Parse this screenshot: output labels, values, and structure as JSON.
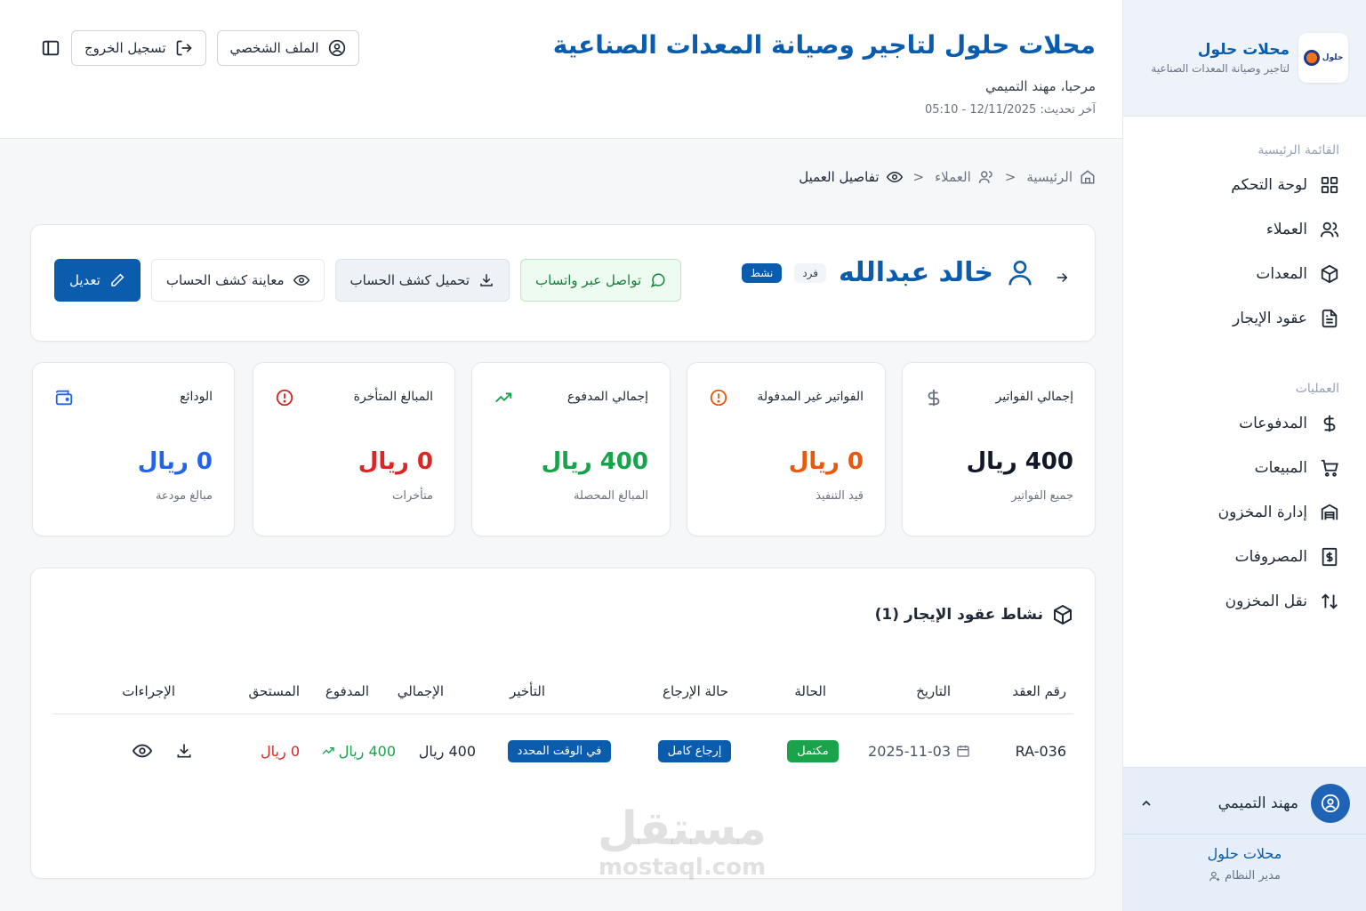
{
  "sidebar": {
    "brand_name": "محلات حلول",
    "brand_sub": "لتاجير وصيانة المعدات الصناعية",
    "logo_text": "حلول",
    "sections": [
      {
        "title": "القائمة الرئيسية",
        "items": [
          {
            "label": "لوحة التحكم",
            "icon": "dashboard-grid-icon"
          },
          {
            "label": "العملاء",
            "icon": "users-icon"
          },
          {
            "label": "المعدات",
            "icon": "box-icon"
          },
          {
            "label": "عقود الإيجار",
            "icon": "document-icon"
          }
        ]
      },
      {
        "title": "العمليات",
        "items": [
          {
            "label": "المدفوعات",
            "icon": "dollar-icon"
          },
          {
            "label": "المبيعات",
            "icon": "cart-icon"
          },
          {
            "label": "إدارة المخزون",
            "icon": "warehouse-icon"
          },
          {
            "label": "المصروفات",
            "icon": "receipt-dollar-icon"
          },
          {
            "label": "نقل المخزون",
            "icon": "transfer-arrows-icon"
          }
        ]
      }
    ],
    "user": {
      "name": "مهند التميمي",
      "org": "محلات حلول",
      "role": "مدير النظام"
    }
  },
  "header": {
    "title": "محلات حلول لتاجير وصيانة المعدات الصناعية",
    "welcome": "مرحبا، مهند التميمي",
    "last_updated": "آخر تحديث: 12/11/2025 - 05:10",
    "profile_label": "الملف الشخصي",
    "logout_label": "تسجيل الخروج"
  },
  "breadcrumb": {
    "home": "الرئيسية",
    "clients": "العملاء",
    "current": "تفاصيل العميل"
  },
  "client": {
    "name": "خالد عبدالله",
    "type_badge": "فرد",
    "status_badge": "نشط",
    "whatsapp_label": "تواصل عبر واتساب",
    "download_label": "تحميل كشف الحساب",
    "preview_label": "معاينة كشف الحساب",
    "edit_label": "تعديل"
  },
  "stats": [
    {
      "label": "إجمالي الفواتير",
      "value": "400 ريال",
      "sub": "جميع الفواتير",
      "color": "#111827",
      "icon": "dollar-icon"
    },
    {
      "label": "الفواتير غير المدفولة",
      "value": "0 ريال",
      "sub": "قيد التنفيذ",
      "color": "#ea580c",
      "icon": "alert-circle-icon"
    },
    {
      "label": "إجمالي المدفوع",
      "value": "400 ريال",
      "sub": "المبالغ المحصلة",
      "color": "#16a34a",
      "icon": "trending-up-icon"
    },
    {
      "label": "المبالغ المتأخرة",
      "value": "0 ريال",
      "sub": "متأخرات",
      "color": "#dc2626",
      "icon": "alert-circle-icon"
    },
    {
      "label": "الودائع",
      "value": "0 ريال",
      "sub": "مبالغ مودعة",
      "color": "#2563eb",
      "icon": "wallet-icon"
    }
  ],
  "contracts": {
    "title": "نشاط عقود الإيجار (1)",
    "columns": [
      "رقم العقد",
      "التاريخ",
      "الحالة",
      "حالة الإرجاع",
      "التأخير",
      "الإجمالي",
      "المدفوع",
      "المستحق",
      "الإجراءات"
    ],
    "rows": [
      {
        "contract_no": "RA-036",
        "date": "2025-11-03",
        "status": "مكتمل",
        "return_status": "إرجاع كامل",
        "delay": "في الوقت المحدد",
        "total": "400 ريال",
        "paid": "400 ريال",
        "due": "0 ريال"
      }
    ]
  },
  "watermark": {
    "ar": "مستقل",
    "en": "mostaql.com"
  },
  "colors": {
    "primary": "#0b5cad",
    "success": "#16a34a",
    "danger": "#dc2626",
    "warning": "#ea580c",
    "info": "#2563eb"
  }
}
